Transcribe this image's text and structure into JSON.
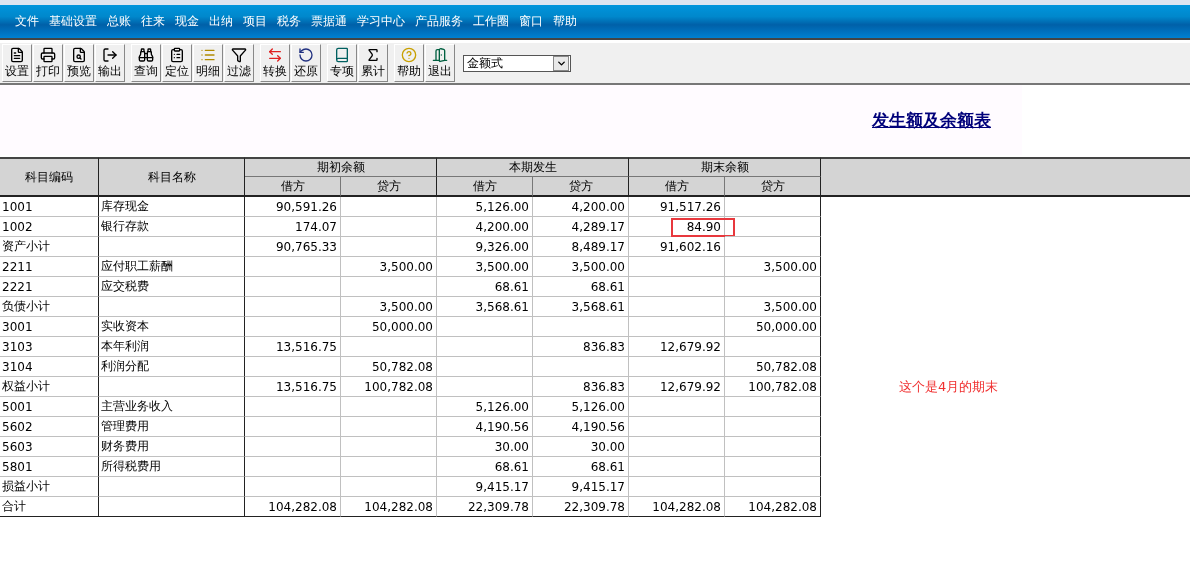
{
  "menu": [
    "文件",
    "基础设置",
    "总账",
    "往来",
    "现金",
    "出纳",
    "项目",
    "税务",
    "票据通",
    "学习中心",
    "产品服务",
    "工作圈",
    "窗口",
    "帮助"
  ],
  "toolbar": {
    "groups": [
      [
        "设置",
        "打印",
        "预览",
        "输出"
      ],
      [
        "查询",
        "定位",
        "明细",
        "过滤"
      ],
      [
        "转换",
        "还原"
      ],
      [
        "专项",
        "累计"
      ],
      [
        "帮助",
        "退出"
      ]
    ],
    "format_select": {
      "value": "金额式"
    }
  },
  "report": {
    "title": "发生额及余额表"
  },
  "table": {
    "columns": [
      {
        "label": "科目编码"
      },
      {
        "label": "科目名称"
      },
      {
        "label": "期初余额",
        "sub": [
          "借方",
          "贷方"
        ]
      },
      {
        "label": "本期发生",
        "sub": [
          "借方",
          "贷方"
        ]
      },
      {
        "label": "期末余额",
        "sub": [
          "借方",
          "贷方"
        ]
      }
    ],
    "rows": [
      {
        "code": "1001",
        "name": "库存现金",
        "cells": {
          "begin_debit": {
            "text": "90,591.26",
            "circled": false
          },
          "period_debit": {
            "text": "5,126.00",
            "circled": false
          },
          "period_credit": {
            "text": "4,200.00",
            "circled": false
          },
          "end_debit": {
            "text": "91,517.26",
            "circled": false
          }
        }
      },
      {
        "code": "1002",
        "name": "银行存款",
        "cells": {
          "begin_debit": {
            "text": "174.07",
            "circled": false
          },
          "period_debit": {
            "text": "4,200.00",
            "circled": false
          },
          "period_credit": {
            "text": "4,289.17",
            "circled": false
          },
          "end_debit": {
            "text": "84.90",
            "circled": true
          }
        }
      },
      {
        "code": "资产小计",
        "cells": {
          "begin_debit": {
            "text": "90,765.33",
            "circled": false
          },
          "period_debit": {
            "text": "9,326.00",
            "circled": false
          },
          "period_credit": {
            "text": "8,489.17",
            "circled": false
          },
          "end_debit": {
            "text": "91,602.16",
            "circled": false
          }
        }
      },
      {
        "code": "2211",
        "name": "应付职工薪酬",
        "cells": {
          "begin_credit": {
            "text": "3,500.00",
            "circled": false
          },
          "period_debit": {
            "text": "3,500.00",
            "circled": false
          },
          "period_credit": {
            "text": "3,500.00",
            "circled": false
          },
          "end_credit": {
            "text": "3,500.00",
            "circled": false
          }
        }
      },
      {
        "code": "2221",
        "name": "应交税费",
        "cells": {
          "period_debit": {
            "text": "68.61",
            "circled": false
          },
          "period_credit": {
            "text": "68.61",
            "circled": false
          }
        }
      },
      {
        "code": "负债小计",
        "cells": {
          "begin_credit": {
            "text": "3,500.00",
            "circled": false
          },
          "period_debit": {
            "text": "3,568.61",
            "circled": false
          },
          "period_credit": {
            "text": "3,568.61",
            "circled": false
          },
          "end_credit": {
            "text": "3,500.00",
            "circled": false
          }
        }
      },
      {
        "code": "3001",
        "name": "实收资本",
        "cells": {
          "begin_credit": {
            "text": "50,000.00",
            "circled": false
          },
          "end_credit": {
            "text": "50,000.00",
            "circled": false
          }
        }
      },
      {
        "code": "3103",
        "name": "本年利润",
        "cells": {
          "begin_debit": {
            "text": "13,516.75",
            "circled": false
          },
          "period_credit": {
            "text": "836.83",
            "circled": false
          },
          "end_debit": {
            "text": "12,679.92",
            "circled": false
          }
        }
      },
      {
        "code": "3104",
        "name": "利润分配",
        "cells": {
          "begin_credit": {
            "text": "50,782.08",
            "circled": false
          },
          "end_credit": {
            "text": "50,782.08",
            "circled": false
          }
        }
      },
      {
        "code": "权益小计",
        "cells": {
          "begin_debit": {
            "text": "13,516.75",
            "circled": false
          },
          "begin_credit": {
            "text": "100,782.08",
            "circled": false
          },
          "period_credit": {
            "text": "836.83",
            "circled": false
          },
          "end_debit": {
            "text": "12,679.92",
            "circled": false
          },
          "end_credit": {
            "text": "100,782.08",
            "circled": false
          }
        },
        "note": "这个是4月的期末"
      },
      {
        "code": "5001",
        "name": "主营业务收入",
        "cells": {
          "period_debit": {
            "text": "5,126.00",
            "circled": false
          },
          "period_credit": {
            "text": "5,126.00",
            "circled": false
          }
        }
      },
      {
        "code": "5602",
        "name": "管理费用",
        "cells": {
          "period_debit": {
            "text": "4,190.56",
            "circled": false
          },
          "period_credit": {
            "text": "4,190.56",
            "circled": false
          }
        }
      },
      {
        "code": "5603",
        "name": "财务费用",
        "cells": {
          "period_debit": {
            "text": "30.00",
            "circled": false
          },
          "period_credit": {
            "text": "30.00",
            "circled": false
          }
        }
      },
      {
        "code": "5801",
        "name": "所得税费用",
        "cells": {
          "period_debit": {
            "text": "68.61",
            "circled": false
          },
          "period_credit": {
            "text": "68.61",
            "circled": false
          }
        }
      },
      {
        "code": "损益小计",
        "cells": {
          "period_debit": {
            "text": "9,415.17",
            "circled": false
          },
          "period_credit": {
            "text": "9,415.17",
            "circled": false
          }
        }
      },
      {
        "code": "合计",
        "cells": {
          "begin_debit": {
            "text": "104,282.08",
            "circled": false
          },
          "begin_credit": {
            "text": "104,282.08",
            "circled": false
          },
          "period_debit": {
            "text": "22,309.78",
            "circled": false
          },
          "period_credit": {
            "text": "22,309.78",
            "circled": false
          },
          "end_debit": {
            "text": "104,282.08",
            "circled": false
          },
          "end_credit": {
            "text": "104,282.08",
            "circled": false
          }
        }
      }
    ]
  }
}
